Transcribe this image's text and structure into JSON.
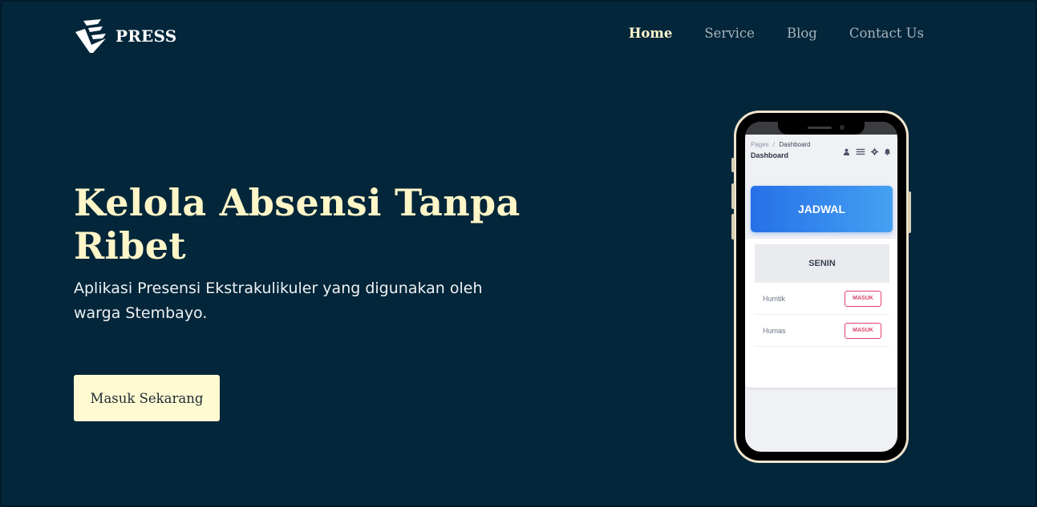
{
  "brand": {
    "name": "PRESS",
    "logo_icon": "chevron-e-logo-icon"
  },
  "nav": {
    "items": [
      {
        "label": "Home",
        "active": true
      },
      {
        "label": "Service",
        "active": false
      },
      {
        "label": "Blog",
        "active": false
      },
      {
        "label": "Contact Us",
        "active": false
      }
    ]
  },
  "hero": {
    "title": "Kelola Absensi Tanpa Ribet",
    "subtitle": "Aplikasi Presensi Ekstrakulikuler yang digunakan oleh warga Stembayo.",
    "cta_label": "Masuk Sekarang"
  },
  "phone_app": {
    "breadcrumb_root": "Pages",
    "breadcrumb_sep": "/",
    "breadcrumb_current": "Dashboard",
    "page_title": "Dashboard",
    "header_icons": [
      "user-icon",
      "menu-icon",
      "gear-icon",
      "bell-icon"
    ],
    "schedule_button": "JADWAL",
    "day": "SENIN",
    "rows": [
      {
        "name": "Humtik",
        "action": "MASUK"
      },
      {
        "name": "Humas",
        "action": "MASUK"
      }
    ]
  },
  "colors": {
    "background": "#03263a",
    "accent": "#fff6c8",
    "app_primary": "#2670e8",
    "danger": "#e0436b"
  }
}
